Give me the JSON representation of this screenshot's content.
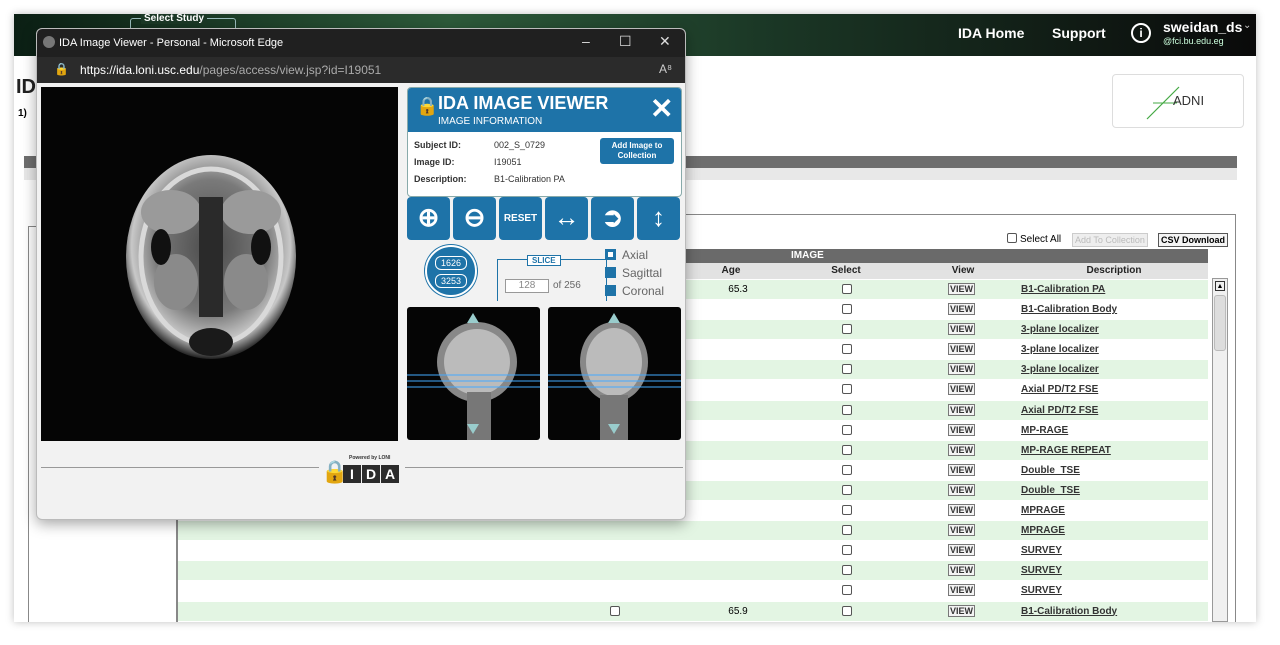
{
  "topbar": {
    "select_study": "Select Study",
    "nav": [
      "IDA Home",
      "Support"
    ],
    "user": {
      "name": "sweidan_ds",
      "email": "@fci.bu.edu.eg"
    }
  },
  "page": {
    "title_fragment": "ID",
    "step_fragment": "1)",
    "adni_logo": "ADNI"
  },
  "table": {
    "select_all_label": "Select All",
    "add_to_collection": "Add To Collection",
    "csv_download": "CSV Download",
    "group_header": "IMAGE",
    "columns": {
      "age": "Age",
      "select": "Select",
      "view": "View",
      "description": "Description"
    },
    "rows": [
      {
        "age": "65.3",
        "view": "VIEW",
        "desc": "B1-Calibration PA",
        "bg": "g"
      },
      {
        "age": "",
        "view": "VIEW",
        "desc": "B1-Calibration Body",
        "bg": "w"
      },
      {
        "age": "",
        "view": "VIEW",
        "desc": "3-plane localizer",
        "bg": "g"
      },
      {
        "age": "",
        "view": "VIEW",
        "desc": "3-plane localizer",
        "bg": "w"
      },
      {
        "age": "",
        "view": "VIEW",
        "desc": "3-plane localizer",
        "bg": "g"
      },
      {
        "age": "",
        "view": "VIEW",
        "desc": "Axial PD/T2 FSE",
        "bg": "w"
      },
      {
        "age": "",
        "view": "VIEW",
        "desc": "Axial PD/T2 FSE",
        "bg": "g"
      },
      {
        "age": "",
        "view": "VIEW",
        "desc": "MP-RAGE",
        "bg": "w"
      },
      {
        "age": "",
        "view": "VIEW",
        "desc": "MP-RAGE REPEAT",
        "bg": "g"
      },
      {
        "age": "",
        "view": "VIEW",
        "desc": "Double_TSE",
        "bg": "w"
      },
      {
        "age": "",
        "view": "VIEW",
        "desc": "Double_TSE",
        "bg": "g"
      },
      {
        "age": "",
        "view": "VIEW",
        "desc": "MPRAGE",
        "bg": "w"
      },
      {
        "age": "",
        "view": "VIEW",
        "desc": "MPRAGE",
        "bg": "g"
      },
      {
        "age": "",
        "view": "VIEW",
        "desc": "SURVEY",
        "bg": "w"
      },
      {
        "age": "",
        "view": "VIEW",
        "desc": "SURVEY",
        "bg": "g"
      },
      {
        "age": "",
        "view": "VIEW",
        "desc": "SURVEY",
        "bg": "w"
      },
      {
        "age": "65.9",
        "view": "VIEW",
        "desc": "B1-Calibration Body",
        "bg": "g"
      }
    ]
  },
  "popup": {
    "window_title": "IDA Image Viewer - Personal - Microsoft Edge",
    "url_host": "https://ida.loni.usc.edu",
    "url_path": "/pages/access/view.jsp?id=I19051",
    "viewer_title": "IDA IMAGE VIEWER",
    "viewer_subtitle": "IMAGE INFORMATION",
    "info": [
      {
        "label": "Subject ID:",
        "value": "002_S_0729"
      },
      {
        "label": "Image ID:",
        "value": "I19051"
      },
      {
        "label": "Description:",
        "value": "B1-Calibration PA"
      }
    ],
    "add_button": "Add Image to Collection",
    "reset_label": "RESET",
    "window_level": {
      "brightness": "1626",
      "contrast": "3253"
    },
    "slice_label": "SLICE",
    "slice_value": "128",
    "slice_total": "of 256",
    "orientations": [
      {
        "label": "Axial",
        "selected": true
      },
      {
        "label": "Sagittal",
        "selected": false
      },
      {
        "label": "Coronal",
        "selected": false
      }
    ],
    "powered_by": "Powered by LONI",
    "logo_letters": [
      "I",
      "D",
      "A"
    ]
  }
}
